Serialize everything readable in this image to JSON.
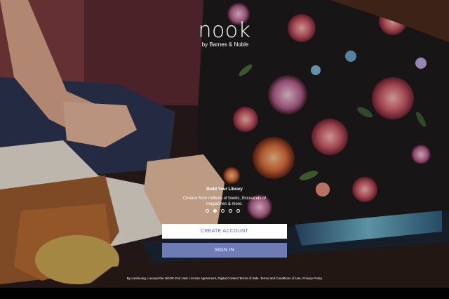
{
  "app": {
    "logo_text": "nook",
    "logo_subtitle": "by Barnes & Noble"
  },
  "slide": {
    "title": "Build Your Library",
    "description": "Choose from millions of books, thousands of magazines & more.",
    "page_count": 5,
    "active_index": 1
  },
  "buttons": {
    "create_account": "CREATE ACCOUNT",
    "sign_in": "SIGN IN"
  },
  "legal": {
    "prefix": "By continuing, I accept the NOOK End User License Agreement, Digital Content Terms of Sale, Terms and Conditions of Use, Privacy Policy"
  },
  "colors": {
    "primary": "#6f7bb4",
    "primary_text": "#5c6bb0"
  }
}
